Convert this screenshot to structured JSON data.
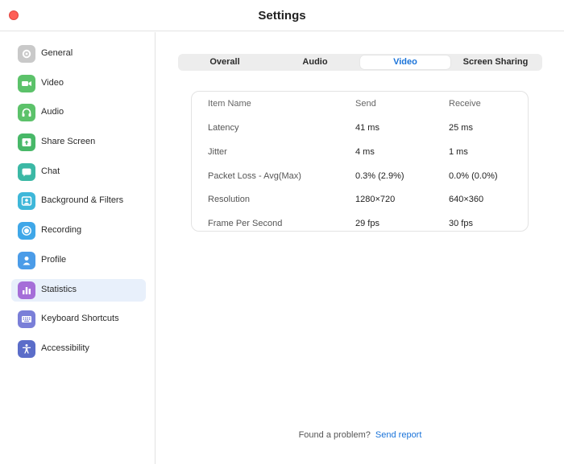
{
  "window": {
    "title": "Settings"
  },
  "sidebar": {
    "items": [
      {
        "label": "General",
        "icon": "gear-icon",
        "color": "#c9c9c9"
      },
      {
        "label": "Video",
        "icon": "video-camera-icon",
        "color": "#5cc26a"
      },
      {
        "label": "Audio",
        "icon": "headphones-icon",
        "color": "#5cc26a"
      },
      {
        "label": "Share Screen",
        "icon": "share-screen-icon",
        "color": "#48b868"
      },
      {
        "label": "Chat",
        "icon": "chat-icon",
        "color": "#3bb8a5"
      },
      {
        "label": "Background & Filters",
        "icon": "background-icon",
        "color": "#3eb7d9"
      },
      {
        "label": "Recording",
        "icon": "record-icon",
        "color": "#3fa7e8"
      },
      {
        "label": "Profile",
        "icon": "profile-icon",
        "color": "#4b9ce8"
      },
      {
        "label": "Statistics",
        "icon": "statistics-icon",
        "color": "#a56ed8"
      },
      {
        "label": "Keyboard Shortcuts",
        "icon": "keyboard-icon",
        "color": "#7a7fd8"
      },
      {
        "label": "Accessibility",
        "icon": "accessibility-icon",
        "color": "#5b6dc9"
      }
    ],
    "active": "Statistics",
    "active_color": "#e8f0fb"
  },
  "tabs": [
    "Overall",
    "Audio",
    "Video",
    "Screen Sharing"
  ],
  "active_tab": "Video",
  "accent_color": "#1a73d9",
  "stats": {
    "headers": [
      "Item Name",
      "Send",
      "Receive"
    ],
    "rows": [
      [
        "Latency",
        "41 ms",
        "25 ms"
      ],
      [
        "Jitter",
        "4 ms",
        "1 ms"
      ],
      [
        "Packet Loss - Avg(Max)",
        "0.3% (2.9%)",
        "0.0% (0.0%)"
      ],
      [
        "Resolution",
        "1280×720",
        "640×360"
      ],
      [
        "Frame Per Second",
        "29 fps",
        "30 fps"
      ]
    ]
  },
  "footer": {
    "text": "Found a problem?",
    "link": "Send report"
  }
}
